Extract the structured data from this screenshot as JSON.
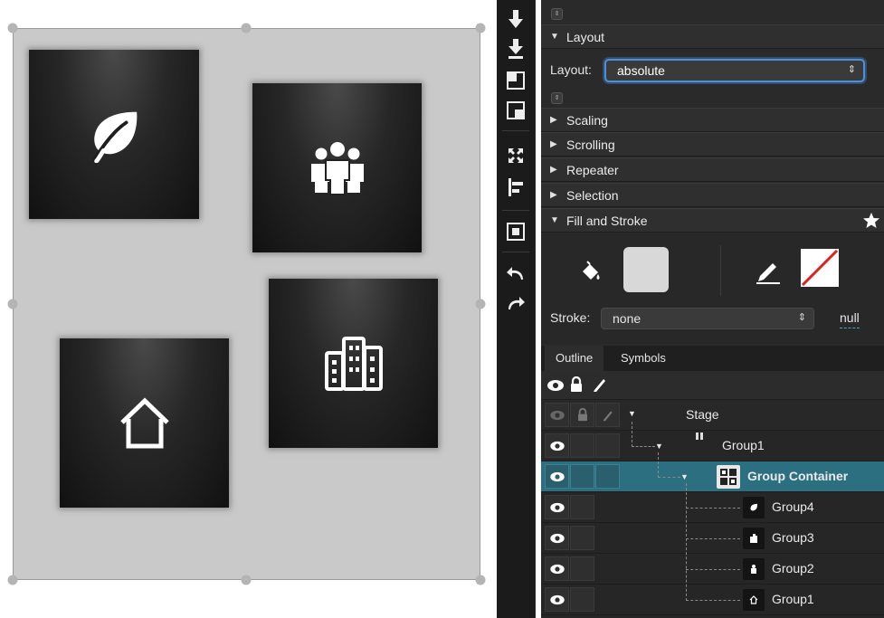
{
  "inspector": {
    "layout_section": "Layout",
    "layout_field_label": "Layout:",
    "layout_value": "absolute",
    "collapsed_sections": [
      "Scaling",
      "Scrolling",
      "Repeater",
      "Selection"
    ],
    "fill_stroke_section": "Fill and Stroke",
    "stroke_label": "Stroke:",
    "stroke_value": "none",
    "stroke_null_label": "null"
  },
  "outline": {
    "tabs": [
      "Outline",
      "Symbols"
    ],
    "stage_label": "Stage",
    "rows": [
      {
        "label": "Group1",
        "icon": "group-icon"
      },
      {
        "label": "Group Container",
        "icon": "grid-icon",
        "selected": true
      },
      {
        "label": "Group4",
        "icon": "leaf-icon"
      },
      {
        "label": "Group3",
        "icon": "building-icon"
      },
      {
        "label": "Group2",
        "icon": "people-icon"
      },
      {
        "label": "Group1",
        "icon": "house-icon"
      }
    ]
  },
  "colors": {
    "selection": "#2b6f80",
    "focus_ring": "#4a8fe0",
    "canvas": "#c9c9c9"
  }
}
